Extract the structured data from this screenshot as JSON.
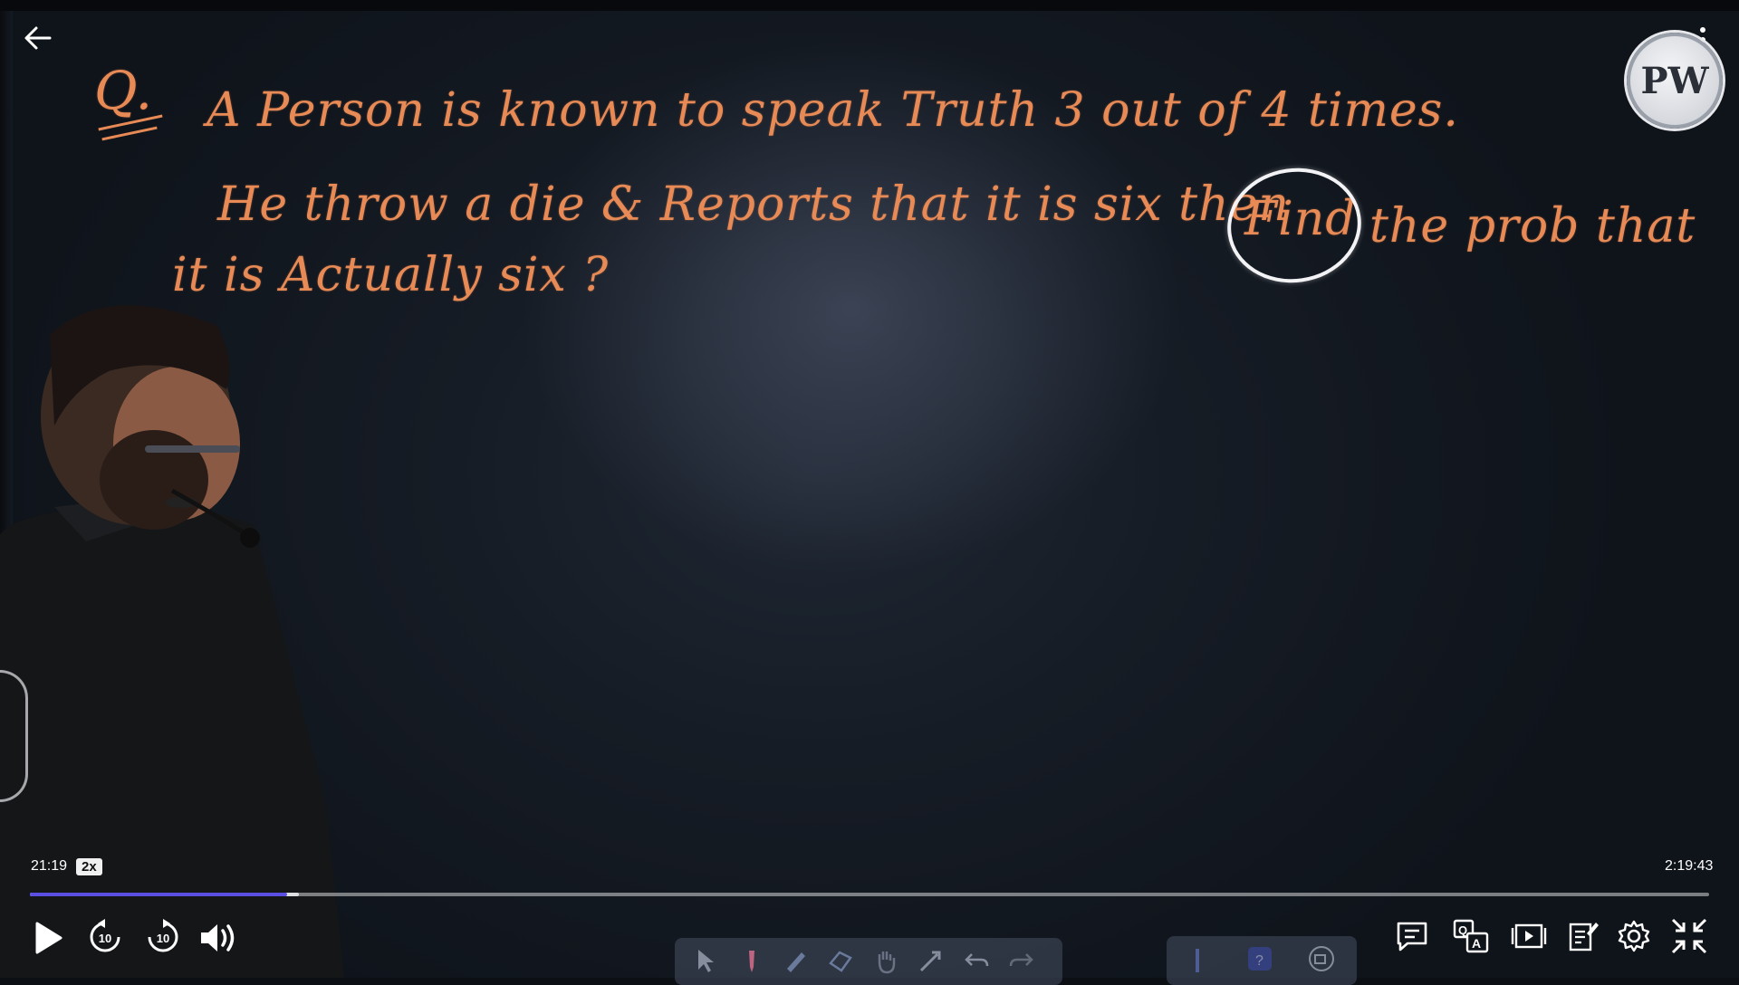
{
  "board": {
    "q_label": "Q.",
    "line1": "A Person is known to speak Truth 3 out of 4 times.",
    "line2_a": "He throw a die & Reports that it is six then",
    "line2_circled": "Find",
    "line2_b": "the prob that",
    "line3": "it is Actually six ?"
  },
  "logo": {
    "text": "PW"
  },
  "player": {
    "current_time": "21:19",
    "speed": "2x",
    "total_time": "2:19:43",
    "progress_fraction": 0.153,
    "buffer_fraction": 0.16,
    "rewind_seconds": "10",
    "forward_seconds": "10"
  },
  "colors": {
    "chalk": "#e88a55",
    "progress": "#5b4fe3",
    "circle": "#f3f3f6"
  },
  "icons": {
    "back": "arrow-left-icon",
    "more": "more-vertical-icon",
    "play": "play-icon",
    "rewind": "rewind-10-icon",
    "forward": "forward-10-icon",
    "volume": "volume-icon",
    "chat": "chat-icon",
    "translate": "translate-icon",
    "playlist": "playlist-icon",
    "notes": "notes-icon",
    "settings": "gear-icon",
    "collapse": "collapse-icon"
  }
}
